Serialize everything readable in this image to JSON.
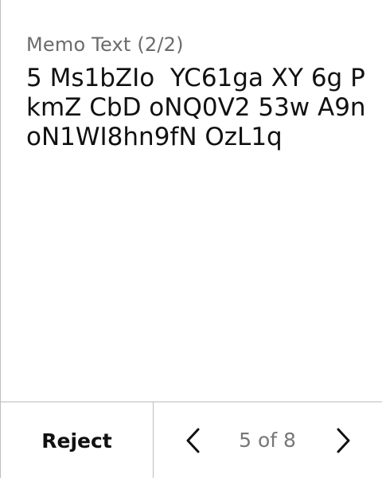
{
  "memo": {
    "label": "Memo Text (2/2)",
    "text": "5 Ms1bZIo  YC61ga XY 6g P kmZ CbD oNQ0V2 53w A9noN1WI8hn9fN OzL1q"
  },
  "footer": {
    "reject_label": "Reject",
    "pager_text": "5 of 8"
  },
  "icons": {
    "prev": "chevron-left-icon",
    "next": "chevron-right-icon"
  },
  "colors": {
    "text": "#111111",
    "muted": "#6b6b6b",
    "divider": "#bdbdbd"
  }
}
